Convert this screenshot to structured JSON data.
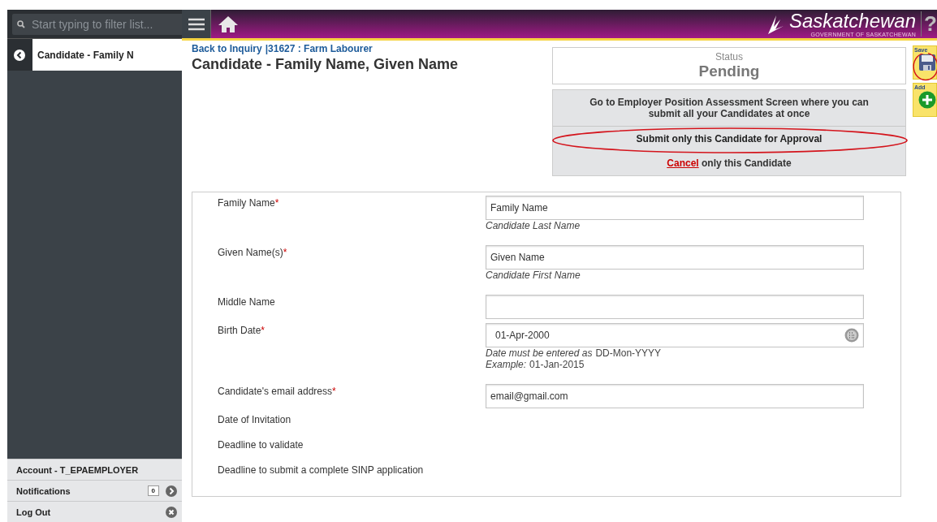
{
  "sidebar": {
    "search": {
      "placeholder": "Start typing to filter list..."
    },
    "current": "Candidate - Family N",
    "account": "Account - T_EPAEMPLOYER",
    "notifications": {
      "label": "Notifications",
      "count": "0"
    },
    "logout": "Log Out"
  },
  "header": {
    "brand": "Saskatchewan",
    "brand_sub": "GOVERNMENT OF SASKATCHEWAN",
    "help": "?"
  },
  "breadcrumb": {
    "link": "Back to Inquiry",
    "rest": "|31627 : Farm Labourer"
  },
  "title": "Candidate - Family Name, Given Name",
  "status": {
    "label": "Status",
    "value": "Pending"
  },
  "actions": [
    {
      "kind": "goto",
      "text": "Go to Employer Position Assessment Screen where you can submit all your Candidates at once",
      "highlighted": false
    },
    {
      "kind": "submit",
      "text": "Submit only this Candidate for Approval",
      "highlighted": true
    },
    {
      "kind": "cancel",
      "link": "Cancel",
      "text": "only this Candidate",
      "highlighted": false
    }
  ],
  "tools": [
    {
      "kind": "save",
      "label": "Save",
      "highlighted": true
    },
    {
      "kind": "add",
      "label": "Add",
      "highlighted": false
    }
  ],
  "fields": [
    {
      "kind": "text",
      "label": "Family Name",
      "required_mark": "*",
      "value": "Family Name",
      "hint": [
        {
          "italic": "Candidate Last Name"
        }
      ]
    },
    {
      "kind": "text",
      "label": "Given Name(s)",
      "required_mark": "*",
      "value": "Given Name",
      "hint": [
        {
          "italic": "Candidate First Name"
        }
      ]
    },
    {
      "kind": "text",
      "label": "Middle Name"
    },
    {
      "kind": "date",
      "label": "Birth Date",
      "required_mark": "*",
      "value": "01-Apr-2000",
      "hint": [
        {
          "italic": "Date must be entered as",
          "plain": "DD-Mon-YYYY"
        },
        {
          "italic": "Example:",
          "plain": "01-Jan-2015"
        }
      ]
    },
    {
      "kind": "text",
      "label": "Candidate's email address",
      "required_mark": "*",
      "value": "email@gmail.com"
    },
    {
      "kind": "info",
      "label": "Date of Invitation"
    },
    {
      "kind": "info",
      "label": "Deadline to validate"
    },
    {
      "kind": "info",
      "label": "Deadline to submit a complete SINP application"
    }
  ]
}
